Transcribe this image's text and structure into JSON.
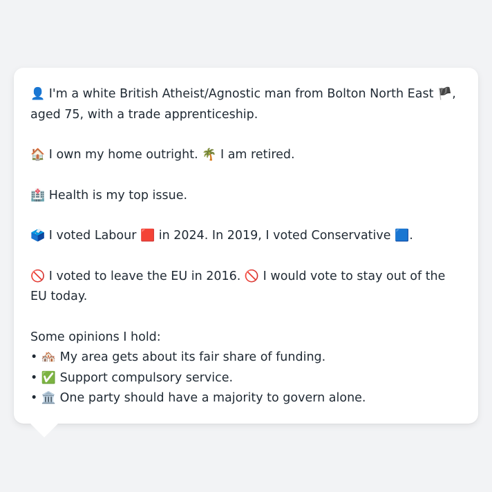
{
  "profile": {
    "intro": {
      "icon": "👤",
      "text_a": "I'm a white British Atheist/Agnostic man from Bolton North East",
      "flag": "🏴",
      "text_b": ", aged 75, with a trade apprenticeship."
    },
    "home": {
      "icon": "🏠",
      "text_a": "I own my home outright.",
      "icon2": "🌴",
      "text_b": "I am retired."
    },
    "issue": {
      "icon": "🏥",
      "text": "Health is my top issue."
    },
    "vote": {
      "icon": "🗳️",
      "text_a": "I voted Labour",
      "labour_square": "🟥",
      "text_b": "in 2024. In 2019, I voted Conservative",
      "con_square": "🟦",
      "text_c": "."
    },
    "eu": {
      "icon": "🚫",
      "text_a": "I voted to leave the EU in 2016.",
      "icon2": "🚫",
      "text_b": "I would vote to stay out of the EU today."
    },
    "opinions": {
      "heading": "Some opinions I hold:",
      "bullet": "•",
      "items": [
        {
          "icon": "🏘️",
          "text": "My area gets about its fair share of funding."
        },
        {
          "icon": "✅",
          "text": "Support compulsory service."
        },
        {
          "icon": "🏛️",
          "text": "One party should have a majority to govern alone."
        }
      ]
    }
  }
}
